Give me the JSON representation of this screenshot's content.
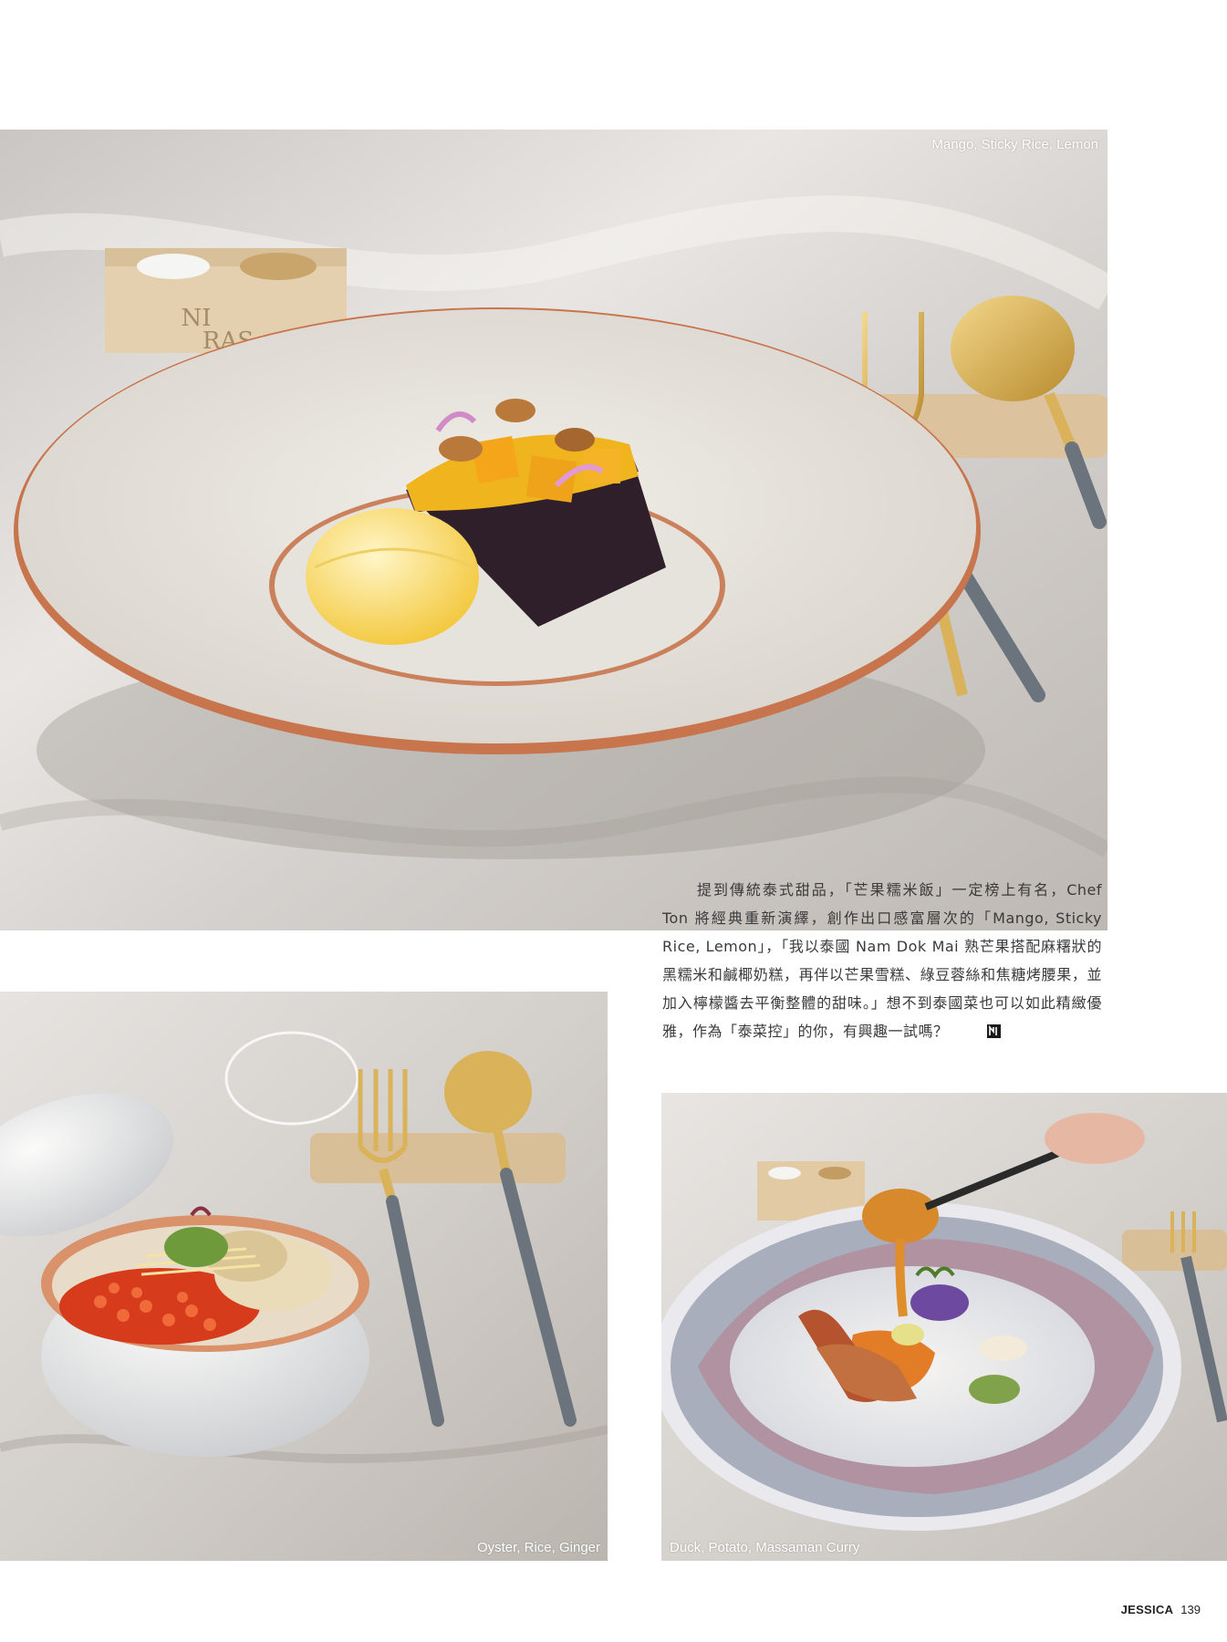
{
  "photos": {
    "main": {
      "caption": "Mango, Sticky Rice, Lemon",
      "box_logo": [
        "NI",
        "RAS"
      ]
    },
    "oyster": {
      "caption": "Oyster, Rice, Ginger"
    },
    "duck": {
      "caption": "Duck, Potato, Massaman Curry"
    }
  },
  "article": {
    "body": "提到傳統泰式甜品，「芒果糯米飯」一定榜上有名，Chef Ton 將經典重新演繹，創作出口感富層次的「Mango, Sticky Rice, Lemon」，「我以泰國 Nam Dok Mai 熟芒果搭配麻糬狀的黑糯米和鹹椰奶糕，再伴以芒果雪糕、綠豆蓉絲和焦糖烤腰果，並加入檸檬醬去平衡整體的甜味。」想不到泰國菜也可以如此精緻優雅，作為「泰菜控」的你，有興趣一試嗎？"
  },
  "footer": {
    "magazine": "JESSICA",
    "page_number": "139"
  },
  "colors": {
    "marble": "#ddd9d6",
    "plate_rim": "#c8754e",
    "mango": "#f0b41e",
    "gold_cutlery": "#d9b25a",
    "cutlery_handle": "#6b747c"
  }
}
